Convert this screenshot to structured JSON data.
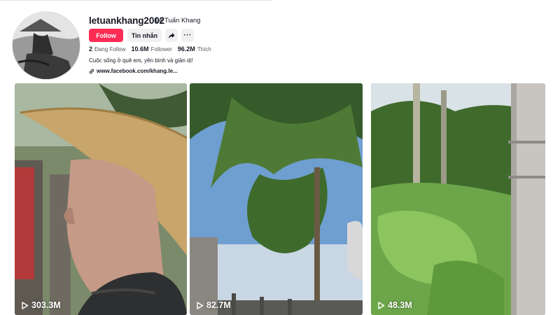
{
  "profile": {
    "username": "letuankhang2002",
    "nickname": "Lê Tuấn Khang",
    "avatar_icon": "avatar-photo"
  },
  "actions": {
    "follow_label": "Follow",
    "message_label": "Tin nhắn",
    "share_icon": "share-icon",
    "more_label": "···"
  },
  "stats": {
    "following_count": "2",
    "following_label": "Đang Follow",
    "followers_count": "10.6M",
    "followers_label": "Follower",
    "likes_count": "96.2M",
    "likes_label": "Thích"
  },
  "bio": "Cuộc sống ở quê em, yên bình và giản dị!",
  "link": {
    "text": "www.facebook.com/khang.le...",
    "icon": "link-icon"
  },
  "videos": [
    {
      "views": "303.3M",
      "icon": "play-icon"
    },
    {
      "views": "82.7M",
      "icon": "play-icon"
    },
    {
      "views": "48.3M",
      "icon": "play-icon"
    }
  ],
  "colors": {
    "accent": "#fe2c55",
    "button_gray": "#f1f1f2",
    "text": "#161823"
  }
}
